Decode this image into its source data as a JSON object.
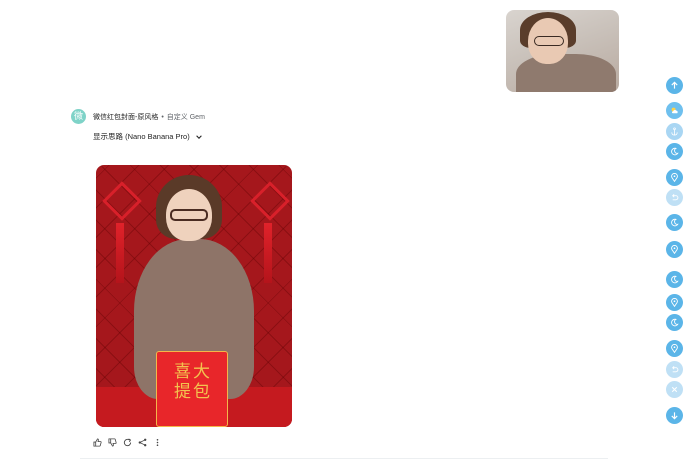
{
  "gem": {
    "avatar_char": "微",
    "name": "微信红包封面-原风格",
    "separator": "•",
    "type": "自定义 Gem",
    "thoughts_label": "显示思路 (Nano Banana Pro)"
  },
  "generated_image": {
    "envelope_text": "喜大\n提包"
  },
  "actions": [
    "thumb-up-icon",
    "thumb-down-icon",
    "regenerate-icon",
    "share-icon",
    "more-vert-icon"
  ],
  "rail": {
    "buttons": [
      {
        "icon": "arrow-up-icon",
        "color": "#5bb5e8"
      },
      {
        "icon": "weather-icon",
        "color": "#6fc0ee"
      },
      {
        "icon": "anchor-icon",
        "color": "#a9d6f3"
      },
      {
        "icon": "moon-icon",
        "color": "#5bb5e8"
      },
      {
        "icon": "pin-icon",
        "color": "#5bb5e8"
      },
      {
        "icon": "undo-icon",
        "color": "#bfe0f5"
      },
      {
        "icon": "moon-icon",
        "color": "#5bb5e8"
      },
      {
        "icon": "pin-icon",
        "color": "#5bb5e8"
      },
      {
        "icon": "moon-icon",
        "color": "#5bb5e8"
      },
      {
        "icon": "pin-icon",
        "color": "#5bb5e8"
      },
      {
        "icon": "moon-icon",
        "color": "#5bb5e8"
      },
      {
        "icon": "pin-icon",
        "color": "#5bb5e8"
      },
      {
        "icon": "undo-icon",
        "color": "#bfe0f5"
      },
      {
        "icon": "close-icon",
        "color": "#bfe0f5"
      },
      {
        "icon": "arrow-down-icon",
        "color": "#5bb5e8"
      }
    ]
  },
  "colors": {
    "accent": "#5bb5e8",
    "avatar": "#7fd3c8",
    "envelope": "#e8262a"
  }
}
